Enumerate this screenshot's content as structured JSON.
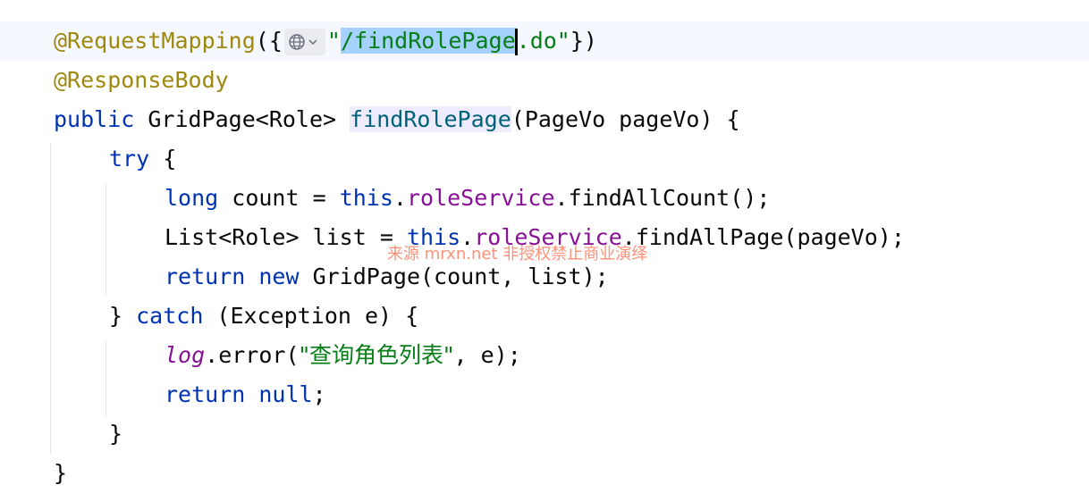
{
  "code": {
    "l1": {
      "ann": "@RequestMapping",
      "open": "({",
      "q1": "\"",
      "slash": "/",
      "sel": "findRolePage",
      "ext": ".do",
      "q2": "\"",
      "close": "})"
    },
    "l2": {
      "ann": "@ResponseBody"
    },
    "l3": {
      "kw": "public",
      "type": " GridPage<Role> ",
      "name": "findRolePage",
      "params": "(PageVo pageVo) {"
    },
    "l4": {
      "kw": "try",
      "rest": " {"
    },
    "l5": {
      "kw": "long",
      "a": " count = ",
      "this": "this",
      "dot": ".",
      "field": "roleService",
      "rest": ".findAllCount();"
    },
    "l6": {
      "a": "List<Role> list = ",
      "this": "this",
      "dot": ".",
      "field": "roleService",
      "rest": ".findAllPage(pageVo);"
    },
    "l7": {
      "kw1": "return",
      "sp": " ",
      "kw2": "new",
      "rest": " GridPage(count, list);"
    },
    "l8": {
      "a": "} ",
      "kw": "catch",
      "rest": " (Exception e) {"
    },
    "l9": {
      "log": "log",
      "a": ".error(",
      "str": "\"查询角色列表\"",
      "rest": ", e);"
    },
    "l10": {
      "kw1": "return",
      "sp": " ",
      "kw2": "null",
      "rest": ";"
    },
    "l11": {
      "a": "}"
    },
    "l12": {
      "a": "}"
    }
  },
  "watermark": "来源 mrxn.net 非授权禁止商业演绎",
  "icons": {
    "url_hint": "globe-icon",
    "chevron": "chevron-down-icon"
  },
  "colors": {
    "annotation": "#9e880d",
    "keyword": "#0033b3",
    "string": "#067d17",
    "field": "#871094",
    "method_decl": "#00627a",
    "selection": "#a6d2ff"
  }
}
